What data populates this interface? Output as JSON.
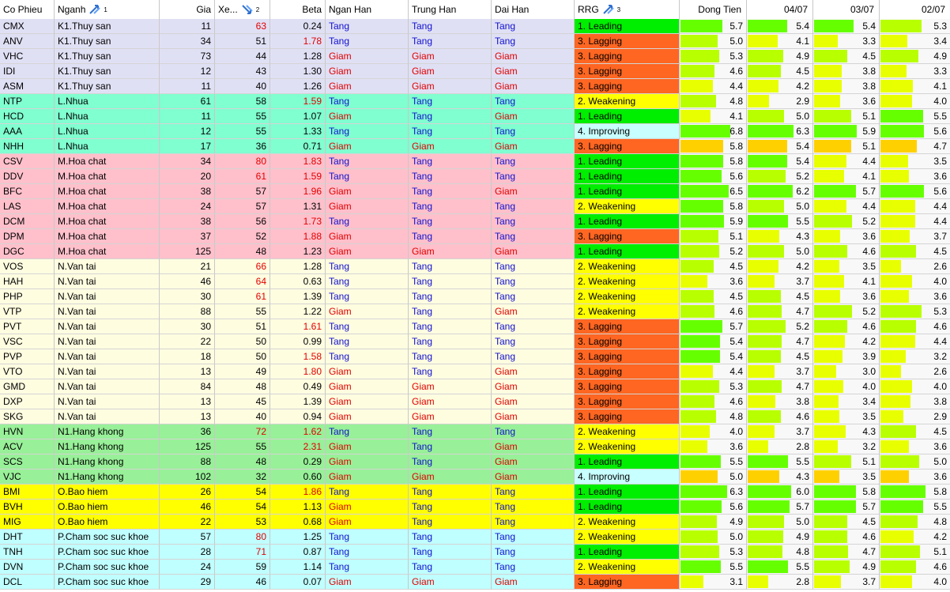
{
  "headers": {
    "co_phieu": "Co Phieu",
    "nganh": "Nganh",
    "nganh_sort": "1",
    "gia": "Gia",
    "xep": "Xe...",
    "xep_sort": "2",
    "beta": "Beta",
    "ngan_han": "Ngan Han",
    "trung_han": "Trung Han",
    "dai_han": "Dai Han",
    "rrg": "RRG",
    "rrg_sort": "3",
    "dong_tien": "Dong Tien",
    "d1": "04/07",
    "d2": "03/07",
    "d3": "02/07"
  },
  "colors": {
    "row_bg": {
      "K1": "#e0e0f5",
      "L": "#80ffd0",
      "M": "#ffc0cb",
      "N": "#fffde0",
      "N1": "#98f098",
      "O": "#ffff00",
      "P": "#c0ffff"
    },
    "rrg_bg": {
      "Leading": "#00ee00",
      "Lagging": "#ff6622",
      "Weakening": "#ffff00",
      "Improving": "#c8ffff"
    },
    "bar": {
      "high": "#66ff00",
      "mid": "#b8ff00",
      "low": "#e8ff00",
      "orange": "#ffd000"
    },
    "tang": "#1010d0",
    "giam": "#e00000"
  },
  "rows": [
    {
      "cp": "CMX",
      "ng": "K1.Thuy san",
      "gia": "11",
      "xep": "63",
      "xep_red": true,
      "beta": "0.24",
      "beta_red": false,
      "nh": "Tang",
      "th": "Tang",
      "dh": "Tang",
      "rrg": "1. Leading",
      "rrg_key": "Leading",
      "dt": 5.7,
      "d1": 5.4,
      "d2": 5.4,
      "d3": 5.3
    },
    {
      "cp": "ANV",
      "ng": "K1.Thuy san",
      "gia": "34",
      "xep": "51",
      "xep_red": false,
      "beta": "1.78",
      "beta_red": true,
      "nh": "Tang",
      "th": "Tang",
      "dh": "Tang",
      "rrg": "3. Lagging",
      "rrg_key": "Lagging",
      "dt": 5.0,
      "d1": 4.1,
      "d2": 3.3,
      "d3": 3.4
    },
    {
      "cp": "VHC",
      "ng": "K1.Thuy san",
      "gia": "73",
      "xep": "44",
      "xep_red": false,
      "beta": "1.28",
      "beta_red": false,
      "nh": "Giam",
      "th": "Giam",
      "dh": "Giam",
      "rrg": "3. Lagging",
      "rrg_key": "Lagging",
      "dt": 5.3,
      "d1": 4.9,
      "d2": 4.5,
      "d3": 4.9
    },
    {
      "cp": "IDI",
      "ng": "K1.Thuy san",
      "gia": "12",
      "xep": "43",
      "xep_red": false,
      "beta": "1.30",
      "beta_red": false,
      "nh": "Giam",
      "th": "Giam",
      "dh": "Giam",
      "rrg": "3. Lagging",
      "rrg_key": "Lagging",
      "dt": 4.6,
      "d1": 4.5,
      "d2": 3.8,
      "d3": 3.3
    },
    {
      "cp": "ASM",
      "ng": "K1.Thuy san",
      "gia": "11",
      "xep": "40",
      "xep_red": false,
      "beta": "1.26",
      "beta_red": false,
      "nh": "Giam",
      "th": "Giam",
      "dh": "Giam",
      "rrg": "3. Lagging",
      "rrg_key": "Lagging",
      "dt": 4.4,
      "d1": 4.2,
      "d2": 3.8,
      "d3": 4.1
    },
    {
      "cp": "NTP",
      "ng": "L.Nhua",
      "gia": "61",
      "xep": "58",
      "xep_red": false,
      "beta": "1.59",
      "beta_red": true,
      "nh": "Tang",
      "th": "Tang",
      "dh": "Tang",
      "rrg": "2. Weakening",
      "rrg_key": "Weakening",
      "dt": 4.8,
      "d1": 2.9,
      "d2": 3.6,
      "d3": 4.0
    },
    {
      "cp": "HCD",
      "ng": "L.Nhua",
      "gia": "11",
      "xep": "55",
      "xep_red": false,
      "beta": "1.07",
      "beta_red": false,
      "nh": "Giam",
      "th": "Tang",
      "dh": "Giam",
      "rrg": "1. Leading",
      "rrg_key": "Leading",
      "dt": 4.1,
      "d1": 5.0,
      "d2": 5.1,
      "d3": 5.5
    },
    {
      "cp": "AAA",
      "ng": "L.Nhua",
      "gia": "12",
      "xep": "55",
      "xep_red": false,
      "beta": "1.33",
      "beta_red": false,
      "nh": "Tang",
      "th": "Tang",
      "dh": "Tang",
      "rrg": "4. Improving",
      "rrg_key": "Improving",
      "dt": 6.8,
      "d1": 6.3,
      "d2": 5.9,
      "d3": 5.6
    },
    {
      "cp": "NHH",
      "ng": "L.Nhua",
      "gia": "17",
      "xep": "36",
      "xep_red": false,
      "beta": "0.71",
      "beta_red": false,
      "nh": "Giam",
      "th": "Giam",
      "dh": "Giam",
      "rrg": "3. Lagging",
      "rrg_key": "Lagging",
      "dt": 5.8,
      "d1": 5.4,
      "d2": 5.1,
      "d3": 4.7,
      "orange": true
    },
    {
      "cp": "CSV",
      "ng": "M.Hoa chat",
      "gia": "34",
      "xep": "80",
      "xep_red": true,
      "beta": "1.83",
      "beta_red": true,
      "nh": "Tang",
      "th": "Tang",
      "dh": "Tang",
      "rrg": "1. Leading",
      "rrg_key": "Leading",
      "dt": 5.8,
      "d1": 5.4,
      "d2": 4.4,
      "d3": 3.5
    },
    {
      "cp": "DDV",
      "ng": "M.Hoa chat",
      "gia": "20",
      "xep": "61",
      "xep_red": true,
      "beta": "1.59",
      "beta_red": true,
      "nh": "Tang",
      "th": "Tang",
      "dh": "Tang",
      "rrg": "1. Leading",
      "rrg_key": "Leading",
      "dt": 5.6,
      "d1": 5.2,
      "d2": 4.1,
      "d3": 3.6
    },
    {
      "cp": "BFC",
      "ng": "M.Hoa chat",
      "gia": "38",
      "xep": "57",
      "xep_red": false,
      "beta": "1.96",
      "beta_red": true,
      "nh": "Giam",
      "th": "Tang",
      "dh": "Giam",
      "rrg": "1. Leading",
      "rrg_key": "Leading",
      "dt": 6.5,
      "d1": 6.2,
      "d2": 5.7,
      "d3": 5.6
    },
    {
      "cp": "LAS",
      "ng": "M.Hoa chat",
      "gia": "24",
      "xep": "57",
      "xep_red": false,
      "beta": "1.31",
      "beta_red": false,
      "nh": "Giam",
      "th": "Tang",
      "dh": "Tang",
      "rrg": "2. Weakening",
      "rrg_key": "Weakening",
      "dt": 5.8,
      "d1": 5.0,
      "d2": 4.4,
      "d3": 4.4
    },
    {
      "cp": "DCM",
      "ng": "M.Hoa chat",
      "gia": "38",
      "xep": "56",
      "xep_red": false,
      "beta": "1.73",
      "beta_red": true,
      "nh": "Tang",
      "th": "Tang",
      "dh": "Tang",
      "rrg": "1. Leading",
      "rrg_key": "Leading",
      "dt": 5.9,
      "d1": 5.5,
      "d2": 5.2,
      "d3": 4.4
    },
    {
      "cp": "DPM",
      "ng": "M.Hoa chat",
      "gia": "37",
      "xep": "52",
      "xep_red": false,
      "beta": "1.88",
      "beta_red": true,
      "nh": "Giam",
      "th": "Tang",
      "dh": "Tang",
      "rrg": "3. Lagging",
      "rrg_key": "Lagging",
      "dt": 5.1,
      "d1": 4.3,
      "d2": 3.6,
      "d3": 3.7
    },
    {
      "cp": "DGC",
      "ng": "M.Hoa chat",
      "gia": "125",
      "xep": "48",
      "xep_red": false,
      "beta": "1.23",
      "beta_red": false,
      "nh": "Giam",
      "th": "Giam",
      "dh": "Giam",
      "rrg": "1. Leading",
      "rrg_key": "Leading",
      "dt": 5.2,
      "d1": 5.0,
      "d2": 4.6,
      "d3": 4.5
    },
    {
      "cp": "VOS",
      "ng": "N.Van tai",
      "gia": "21",
      "xep": "66",
      "xep_red": true,
      "beta": "1.28",
      "beta_red": false,
      "nh": "Tang",
      "th": "Tang",
      "dh": "Tang",
      "rrg": "2. Weakening",
      "rrg_key": "Weakening",
      "dt": 4.5,
      "d1": 4.2,
      "d2": 3.5,
      "d3": 2.6
    },
    {
      "cp": "HAH",
      "ng": "N.Van tai",
      "gia": "46",
      "xep": "64",
      "xep_red": true,
      "beta": "0.63",
      "beta_red": false,
      "nh": "Tang",
      "th": "Tang",
      "dh": "Tang",
      "rrg": "2. Weakening",
      "rrg_key": "Weakening",
      "dt": 3.6,
      "d1": 3.7,
      "d2": 4.1,
      "d3": 4.0
    },
    {
      "cp": "PHP",
      "ng": "N.Van tai",
      "gia": "30",
      "xep": "61",
      "xep_red": true,
      "beta": "1.39",
      "beta_red": false,
      "nh": "Tang",
      "th": "Tang",
      "dh": "Tang",
      "rrg": "2. Weakening",
      "rrg_key": "Weakening",
      "dt": 4.5,
      "d1": 4.5,
      "d2": 3.6,
      "d3": 3.6
    },
    {
      "cp": "VTP",
      "ng": "N.Van tai",
      "gia": "88",
      "xep": "55",
      "xep_red": false,
      "beta": "1.22",
      "beta_red": false,
      "nh": "Giam",
      "th": "Tang",
      "dh": "Giam",
      "rrg": "2. Weakening",
      "rrg_key": "Weakening",
      "dt": 4.6,
      "d1": 4.7,
      "d2": 5.2,
      "d3": 5.3
    },
    {
      "cp": "PVT",
      "ng": "N.Van tai",
      "gia": "30",
      "xep": "51",
      "xep_red": false,
      "beta": "1.61",
      "beta_red": true,
      "nh": "Tang",
      "th": "Tang",
      "dh": "Tang",
      "rrg": "3. Lagging",
      "rrg_key": "Lagging",
      "dt": 5.7,
      "d1": 5.2,
      "d2": 4.6,
      "d3": 4.6
    },
    {
      "cp": "VSC",
      "ng": "N.Van tai",
      "gia": "22",
      "xep": "50",
      "xep_red": false,
      "beta": "0.99",
      "beta_red": false,
      "nh": "Tang",
      "th": "Tang",
      "dh": "Tang",
      "rrg": "3. Lagging",
      "rrg_key": "Lagging",
      "dt": 5.4,
      "d1": 4.7,
      "d2": 4.2,
      "d3": 4.4
    },
    {
      "cp": "PVP",
      "ng": "N.Van tai",
      "gia": "18",
      "xep": "50",
      "xep_red": false,
      "beta": "1.58",
      "beta_red": true,
      "nh": "Tang",
      "th": "Tang",
      "dh": "Tang",
      "rrg": "3. Lagging",
      "rrg_key": "Lagging",
      "dt": 5.4,
      "d1": 4.5,
      "d2": 3.9,
      "d3": 3.2
    },
    {
      "cp": "VTO",
      "ng": "N.Van tai",
      "gia": "13",
      "xep": "49",
      "xep_red": false,
      "beta": "1.80",
      "beta_red": true,
      "nh": "Giam",
      "th": "Tang",
      "dh": "Giam",
      "rrg": "3. Lagging",
      "rrg_key": "Lagging",
      "dt": 4.4,
      "d1": 3.7,
      "d2": 3.0,
      "d3": 2.6
    },
    {
      "cp": "GMD",
      "ng": "N.Van tai",
      "gia": "84",
      "xep": "48",
      "xep_red": false,
      "beta": "0.49",
      "beta_red": false,
      "nh": "Giam",
      "th": "Giam",
      "dh": "Giam",
      "rrg": "3. Lagging",
      "rrg_key": "Lagging",
      "dt": 5.3,
      "d1": 4.7,
      "d2": 4.0,
      "d3": 4.0
    },
    {
      "cp": "DXP",
      "ng": "N.Van tai",
      "gia": "13",
      "xep": "45",
      "xep_red": false,
      "beta": "1.39",
      "beta_red": false,
      "nh": "Giam",
      "th": "Giam",
      "dh": "Giam",
      "rrg": "3. Lagging",
      "rrg_key": "Lagging",
      "dt": 4.6,
      "d1": 3.8,
      "d2": 3.4,
      "d3": 3.8
    },
    {
      "cp": "SKG",
      "ng": "N.Van tai",
      "gia": "13",
      "xep": "40",
      "xep_red": false,
      "beta": "0.94",
      "beta_red": false,
      "nh": "Giam",
      "th": "Giam",
      "dh": "Giam",
      "rrg": "3. Lagging",
      "rrg_key": "Lagging",
      "dt": 4.8,
      "d1": 4.6,
      "d2": 3.5,
      "d3": 2.9
    },
    {
      "cp": "HVN",
      "ng": "N1.Hang khong",
      "gia": "36",
      "xep": "72",
      "xep_red": true,
      "beta": "1.62",
      "beta_red": true,
      "nh": "Tang",
      "th": "Tang",
      "dh": "Tang",
      "rrg": "2. Weakening",
      "rrg_key": "Weakening",
      "dt": 4.0,
      "d1": 3.7,
      "d2": 4.3,
      "d3": 4.5
    },
    {
      "cp": "ACV",
      "ng": "N1.Hang khong",
      "gia": "125",
      "xep": "55",
      "xep_red": false,
      "beta": "2.31",
      "beta_red": true,
      "nh": "Giam",
      "th": "Tang",
      "dh": "Giam",
      "rrg": "2. Weakening",
      "rrg_key": "Weakening",
      "dt": 3.6,
      "d1": 2.8,
      "d2": 3.2,
      "d3": 3.6
    },
    {
      "cp": "SCS",
      "ng": "N1.Hang khong",
      "gia": "88",
      "xep": "48",
      "xep_red": false,
      "beta": "0.29",
      "beta_red": false,
      "nh": "Giam",
      "th": "Tang",
      "dh": "Giam",
      "rrg": "1. Leading",
      "rrg_key": "Leading",
      "dt": 5.5,
      "d1": 5.5,
      "d2": 5.1,
      "d3": 5.0
    },
    {
      "cp": "VJC",
      "ng": "N1.Hang khong",
      "gia": "102",
      "xep": "32",
      "xep_red": false,
      "beta": "0.60",
      "beta_red": false,
      "nh": "Giam",
      "th": "Giam",
      "dh": "Giam",
      "rrg": "4. Improving",
      "rrg_key": "Improving",
      "dt": 5.0,
      "d1": 4.3,
      "d2": 3.5,
      "d3": 3.6,
      "orange": true
    },
    {
      "cp": "BMI",
      "ng": "O.Bao hiem",
      "gia": "26",
      "xep": "54",
      "xep_red": false,
      "beta": "1.86",
      "beta_red": true,
      "nh": "Tang",
      "th": "Tang",
      "dh": "Tang",
      "rrg": "1. Leading",
      "rrg_key": "Leading",
      "dt": 6.3,
      "d1": 6.0,
      "d2": 5.8,
      "d3": 5.8
    },
    {
      "cp": "BVH",
      "ng": "O.Bao hiem",
      "gia": "46",
      "xep": "54",
      "xep_red": false,
      "beta": "1.13",
      "beta_red": false,
      "nh": "Giam",
      "th": "Tang",
      "dh": "Tang",
      "rrg": "1. Leading",
      "rrg_key": "Leading",
      "dt": 5.6,
      "d1": 5.7,
      "d2": 5.7,
      "d3": 5.5
    },
    {
      "cp": "MIG",
      "ng": "O.Bao hiem",
      "gia": "22",
      "xep": "53",
      "xep_red": false,
      "beta": "0.68",
      "beta_red": false,
      "nh": "Giam",
      "th": "Tang",
      "dh": "Tang",
      "rrg": "2. Weakening",
      "rrg_key": "Weakening",
      "dt": 4.9,
      "d1": 5.0,
      "d2": 4.5,
      "d3": 4.8
    },
    {
      "cp": "DHT",
      "ng": "P.Cham soc suc khoe",
      "gia": "57",
      "xep": "80",
      "xep_red": true,
      "beta": "1.25",
      "beta_red": false,
      "nh": "Tang",
      "th": "Tang",
      "dh": "Tang",
      "rrg": "2. Weakening",
      "rrg_key": "Weakening",
      "dt": 5.0,
      "d1": 4.9,
      "d2": 4.6,
      "d3": 4.2
    },
    {
      "cp": "TNH",
      "ng": "P.Cham soc suc khoe",
      "gia": "28",
      "xep": "71",
      "xep_red": true,
      "beta": "0.87",
      "beta_red": false,
      "nh": "Tang",
      "th": "Tang",
      "dh": "Tang",
      "rrg": "1. Leading",
      "rrg_key": "Leading",
      "dt": 5.3,
      "d1": 4.8,
      "d2": 4.7,
      "d3": 5.1
    },
    {
      "cp": "DVN",
      "ng": "P.Cham soc suc khoe",
      "gia": "24",
      "xep": "59",
      "xep_red": false,
      "beta": "1.14",
      "beta_red": false,
      "nh": "Tang",
      "th": "Tang",
      "dh": "Tang",
      "rrg": "2. Weakening",
      "rrg_key": "Weakening",
      "dt": 5.5,
      "d1": 5.5,
      "d2": 4.9,
      "d3": 4.6
    },
    {
      "cp": "DCL",
      "ng": "P.Cham soc suc khoe",
      "gia": "29",
      "xep": "46",
      "xep_red": false,
      "beta": "0.07",
      "beta_red": false,
      "nh": "Giam",
      "th": "Giam",
      "dh": "Giam",
      "rrg": "3. Lagging",
      "rrg_key": "Lagging",
      "dt": 3.1,
      "d1": 2.8,
      "d2": 3.7,
      "d3": 4.0
    }
  ]
}
